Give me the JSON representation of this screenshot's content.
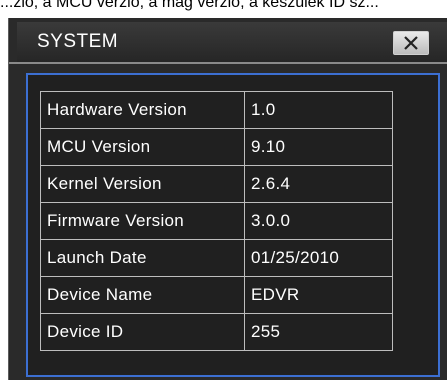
{
  "caption": "...zió, a MCU verzió, a mag verzió, a készülék ID sz...",
  "window": {
    "title": "SYSTEM",
    "close_icon": "close-icon"
  },
  "rows": [
    {
      "label": "Hardware Version",
      "value": "1.0"
    },
    {
      "label": "MCU Version",
      "value": "9.10"
    },
    {
      "label": "Kernel Version",
      "value": "2.6.4"
    },
    {
      "label": "Firmware Version",
      "value": "3.0.0"
    },
    {
      "label": "Launch Date",
      "value": "01/25/2010"
    },
    {
      "label": "Device Name",
      "value": "EDVR"
    },
    {
      "label": "Device ID",
      "value": "255"
    }
  ],
  "colors": {
    "panel_border": "#3c6fd2",
    "background": "#2a2a2a",
    "text": "#ffffff"
  }
}
